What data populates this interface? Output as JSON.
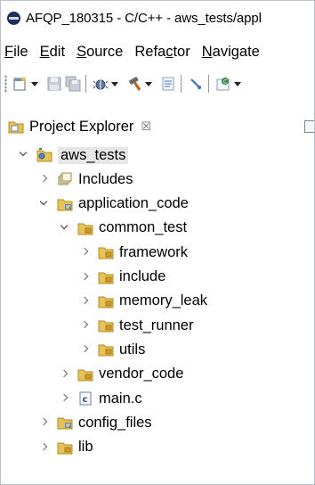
{
  "window": {
    "title": "AFQP_180315 - C/C++ - aws_tests/appl"
  },
  "menubar": {
    "items": [
      {
        "mnemonic": "F",
        "rest": "ile"
      },
      {
        "mnemonic": "E",
        "rest": "dit"
      },
      {
        "mnemonic": "S",
        "rest": "ource"
      },
      {
        "mnemonic": "",
        "rest": "Refa",
        "mnemonic_mid": "c",
        "tail": "tor"
      },
      {
        "mnemonic": "N",
        "rest": "avigate"
      }
    ]
  },
  "toolbar": {
    "icons": [
      "new-file-icon",
      "save-icon",
      "save-all-icon",
      "debug-icon",
      "build-hammer-icon",
      "build-target-icon",
      "pin-icon",
      "new-class-icon"
    ]
  },
  "project_explorer": {
    "tab_label": "Project Explorer",
    "close_glyph": "☒",
    "tree": [
      {
        "label": "aws_tests",
        "level": 0,
        "state": "open",
        "icon": "project-icon",
        "selected": true
      },
      {
        "label": "Includes",
        "level": 1,
        "state": "closed",
        "icon": "includes-icon"
      },
      {
        "label": "application_code",
        "level": 1,
        "state": "open",
        "icon": "source-folder-icon"
      },
      {
        "label": "common_test",
        "level": 2,
        "state": "open",
        "icon": "folder-icon"
      },
      {
        "label": "framework",
        "level": 3,
        "state": "closed",
        "icon": "folder-icon"
      },
      {
        "label": "include",
        "level": 3,
        "state": "closed",
        "icon": "folder-icon"
      },
      {
        "label": "memory_leak",
        "level": 3,
        "state": "closed",
        "icon": "folder-icon"
      },
      {
        "label": "test_runner",
        "level": 3,
        "state": "closed",
        "icon": "folder-icon"
      },
      {
        "label": "utils",
        "level": 3,
        "state": "closed",
        "icon": "folder-icon"
      },
      {
        "label": "vendor_code",
        "level": 2,
        "state": "closed",
        "icon": "folder-icon"
      },
      {
        "label": "main.c",
        "level": 2,
        "state": "closed",
        "icon": "c-file-icon"
      },
      {
        "label": "config_files",
        "level": 1,
        "state": "closed",
        "icon": "source-folder-icon"
      },
      {
        "label": "lib",
        "level": 1,
        "state": "closed",
        "icon": "folder-icon"
      }
    ]
  },
  "colors": {
    "folder": "#d9b44a",
    "folder_dark": "#b58a1f",
    "selection": "#e6e6e6",
    "border": "#b9c2cf"
  }
}
